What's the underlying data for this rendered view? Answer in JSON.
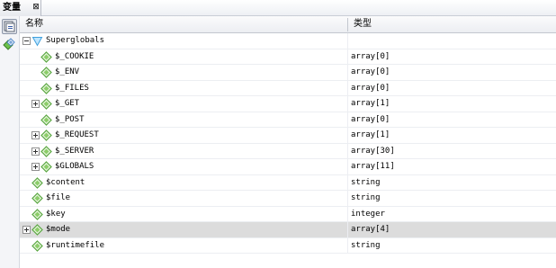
{
  "tab": {
    "title": "变量",
    "close_glyph": "⊠"
  },
  "columns": {
    "name": "名称",
    "type": "类型"
  },
  "icons": {
    "tool_1": "variables-view-icon",
    "tool_2": "add-watch-icon",
    "group": "superglobals-icon",
    "variable": "variable-diamond-icon"
  },
  "colors": {
    "variable": "#5ba843",
    "group": "#3f9fdc",
    "selected_row": "#dcdcdc"
  },
  "rows": [
    {
      "name": "Superglobals",
      "type": "",
      "level": 0,
      "expander": "minus",
      "icon": "group",
      "selected": false
    },
    {
      "name": "$_COOKIE",
      "type": "array[0]",
      "level": 1,
      "expander": "",
      "icon": "variable",
      "selected": false
    },
    {
      "name": "$_ENV",
      "type": "array[0]",
      "level": 1,
      "expander": "",
      "icon": "variable",
      "selected": false
    },
    {
      "name": "$_FILES",
      "type": "array[0]",
      "level": 1,
      "expander": "",
      "icon": "variable",
      "selected": false
    },
    {
      "name": "$_GET",
      "type": "array[1]",
      "level": 1,
      "expander": "plus",
      "icon": "variable",
      "selected": false
    },
    {
      "name": "$_POST",
      "type": "array[0]",
      "level": 1,
      "expander": "",
      "icon": "variable",
      "selected": false
    },
    {
      "name": "$_REQUEST",
      "type": "array[1]",
      "level": 1,
      "expander": "plus",
      "icon": "variable",
      "selected": false
    },
    {
      "name": "$_SERVER",
      "type": "array[30]",
      "level": 1,
      "expander": "plus",
      "icon": "variable",
      "selected": false
    },
    {
      "name": "$GLOBALS",
      "type": "array[11]",
      "level": 1,
      "expander": "plus",
      "icon": "variable",
      "selected": false
    },
    {
      "name": "$content",
      "type": "string",
      "level": 0,
      "expander": "",
      "icon": "variable",
      "selected": false
    },
    {
      "name": "$file",
      "type": "string",
      "level": 0,
      "expander": "",
      "icon": "variable",
      "selected": false
    },
    {
      "name": "$key",
      "type": "integer",
      "level": 0,
      "expander": "",
      "icon": "variable",
      "selected": false
    },
    {
      "name": "$mode",
      "type": "array[4]",
      "level": 0,
      "expander": "plus",
      "icon": "variable",
      "selected": true
    },
    {
      "name": "$runtimefile",
      "type": "string",
      "level": 0,
      "expander": "",
      "icon": "variable",
      "selected": false
    }
  ]
}
